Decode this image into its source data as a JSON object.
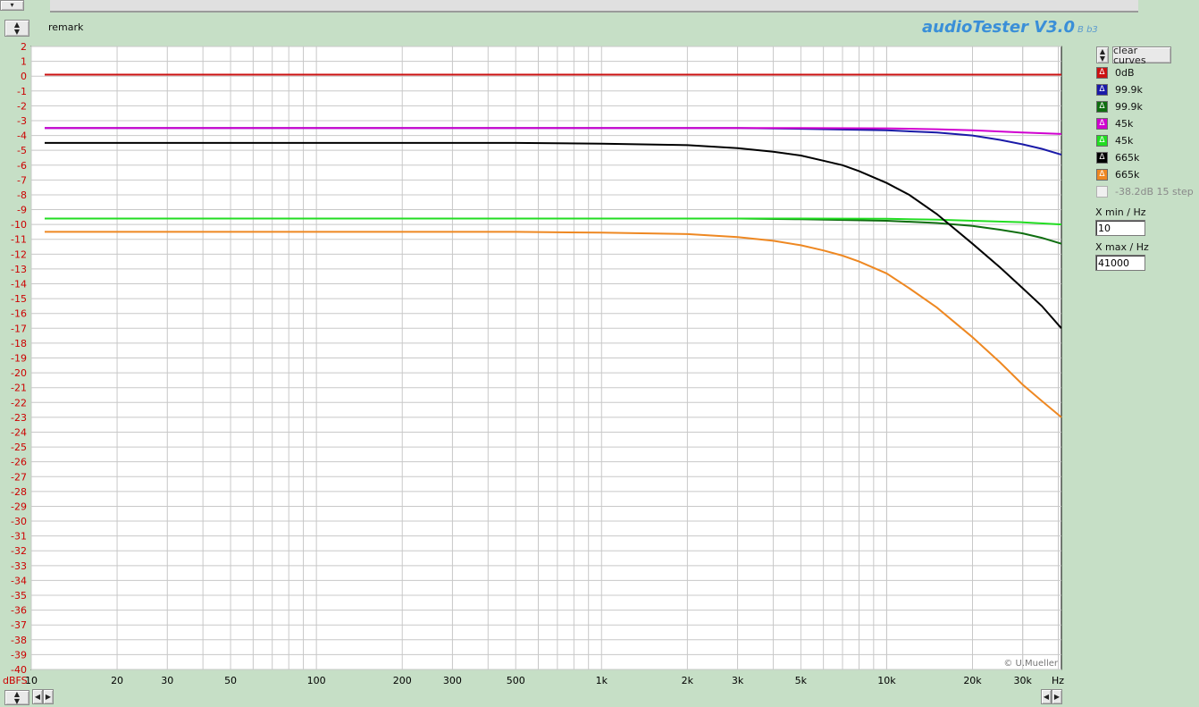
{
  "app": {
    "title": "audioTester V3.0",
    "version_suffix": "B b3",
    "remark": "remark",
    "copyright": "© U.Mueller"
  },
  "controls": {
    "clear_curves_label": "clear curves",
    "xmin_label": "X min / Hz",
    "xmin_value": "10",
    "xmax_label": "X max / Hz",
    "xmax_value": "41000",
    "spin_up_icon": "arrow-up-icon",
    "spin_down_icon": "arrow-down-icon"
  },
  "legend": [
    {
      "label": "0dB",
      "color": "#cc1111",
      "enabled": true
    },
    {
      "label": "99.9k",
      "color": "#1a1aa8",
      "enabled": true
    },
    {
      "label": "99.9k",
      "color": "#0f6e10",
      "enabled": true
    },
    {
      "label": "45k",
      "color": "#d000d0",
      "enabled": true
    },
    {
      "label": "45k",
      "color": "#22dd22",
      "enabled": true
    },
    {
      "label": "665k",
      "color": "#000000",
      "enabled": true
    },
    {
      "label": "665k",
      "color": "#ee8822",
      "enabled": true
    },
    {
      "label": "-38.2dB 15 step",
      "color": "#cccccc",
      "enabled": false
    }
  ],
  "chart_data": {
    "type": "line",
    "title": "",
    "xlabel": "Hz",
    "ylabel": "dBFS",
    "xscale": "log",
    "xlim": [
      10,
      41000
    ],
    "ylim": [
      -40,
      2
    ],
    "grid": true,
    "legend_position": "right",
    "x_tick_labels": [
      "10",
      "20",
      "30",
      "50",
      "100",
      "200",
      "300",
      "500",
      "1k",
      "2k",
      "3k",
      "5k",
      "10k",
      "20k",
      "30k",
      "Hz"
    ],
    "x_tick_values": [
      10,
      20,
      30,
      50,
      100,
      200,
      300,
      500,
      1000,
      2000,
      3000,
      5000,
      10000,
      20000,
      30000
    ],
    "y_tick_labels": [
      "2",
      "1",
      "0",
      "-1",
      "-2",
      "-3",
      "-4",
      "-5",
      "-6",
      "-7",
      "-8",
      "-9",
      "-10",
      "-11",
      "-12",
      "-13",
      "-14",
      "-15",
      "-16",
      "-17",
      "-18",
      "-19",
      "-20",
      "-21",
      "-22",
      "-23",
      "-24",
      "-25",
      "-26",
      "-27",
      "-28",
      "-29",
      "-30",
      "-31",
      "-32",
      "-33",
      "-34",
      "-35",
      "-36",
      "-37",
      "-38",
      "-39",
      "-40"
    ],
    "series": [
      {
        "name": "0dB",
        "color": "#cc1111",
        "x": [
          10,
          100,
          1000,
          10000,
          41000
        ],
        "y": [
          0.1,
          0.1,
          0.1,
          0.1,
          0.1
        ]
      },
      {
        "name": "99.9k",
        "color": "#1a1aa8",
        "x": [
          10,
          1000,
          3000,
          5000,
          10000,
          15000,
          20000,
          25000,
          30000,
          35000,
          41000
        ],
        "y": [
          -3.5,
          -3.5,
          -3.5,
          -3.55,
          -3.65,
          -3.8,
          -4.0,
          -4.3,
          -4.6,
          -4.9,
          -5.3
        ]
      },
      {
        "name": "99.9k",
        "color": "#0f6e10",
        "x": [
          10,
          1000,
          3000,
          5000,
          10000,
          15000,
          20000,
          25000,
          30000,
          35000,
          41000
        ],
        "y": [
          -9.6,
          -9.6,
          -9.6,
          -9.65,
          -9.75,
          -9.9,
          -10.1,
          -10.35,
          -10.6,
          -10.9,
          -11.3
        ]
      },
      {
        "name": "45k",
        "color": "#d000d0",
        "x": [
          10,
          1000,
          5000,
          10000,
          15000,
          20000,
          30000,
          41000
        ],
        "y": [
          -3.5,
          -3.5,
          -3.5,
          -3.52,
          -3.58,
          -3.65,
          -3.8,
          -3.9
        ]
      },
      {
        "name": "45k",
        "color": "#22dd22",
        "x": [
          10,
          1000,
          5000,
          10000,
          15000,
          20000,
          30000,
          41000
        ],
        "y": [
          -9.6,
          -9.6,
          -9.6,
          -9.62,
          -9.68,
          -9.75,
          -9.85,
          -10.0
        ]
      },
      {
        "name": "665k",
        "color": "#000000",
        "x": [
          10,
          500,
          1000,
          2000,
          3000,
          4000,
          5000,
          6000,
          7000,
          8000,
          10000,
          12000,
          15000,
          20000,
          25000,
          30000,
          35000,
          41000
        ],
        "y": [
          -4.5,
          -4.5,
          -4.55,
          -4.65,
          -4.85,
          -5.1,
          -5.35,
          -5.7,
          -6.0,
          -6.4,
          -7.2,
          -8.0,
          -9.3,
          -11.3,
          -12.9,
          -14.3,
          -15.5,
          -17.0
        ]
      },
      {
        "name": "665k",
        "color": "#ee8822",
        "x": [
          10,
          500,
          1000,
          2000,
          3000,
          4000,
          5000,
          6000,
          7000,
          8000,
          10000,
          12000,
          15000,
          20000,
          25000,
          30000,
          35000,
          41000
        ],
        "y": [
          -10.5,
          -10.5,
          -10.55,
          -10.65,
          -10.85,
          -11.1,
          -11.4,
          -11.75,
          -12.1,
          -12.5,
          -13.3,
          -14.3,
          -15.6,
          -17.6,
          -19.3,
          -20.8,
          -21.9,
          -23.0
        ]
      }
    ]
  }
}
